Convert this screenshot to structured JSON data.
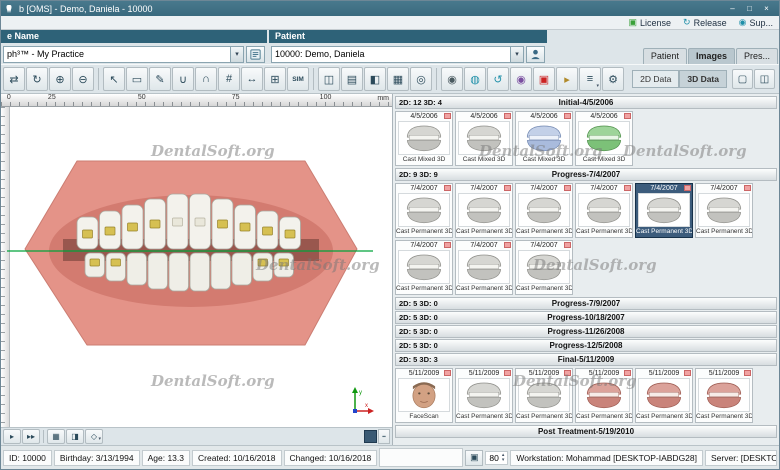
{
  "window": {
    "title": "b [OMS] - Demo, Daniela - 10000"
  },
  "titlebar_controls": [
    {
      "name": "minimize-button",
      "glyph": "–"
    },
    {
      "name": "maximize-button",
      "glyph": "□"
    },
    {
      "name": "close-button",
      "glyph": "×"
    }
  ],
  "top_status": [
    {
      "name": "license",
      "label": "License",
      "glyph": "▣",
      "color": "#3aa13a"
    },
    {
      "name": "release",
      "label": "Release",
      "glyph": "↻",
      "color": "#1e8fa8"
    },
    {
      "name": "support",
      "label": "Sup...",
      "glyph": "◉",
      "color": "#1e8fa8"
    }
  ],
  "practice": {
    "header": "e Name",
    "value": "ph³™ - My Practice"
  },
  "patient": {
    "header": "Patient",
    "value": "10000: Demo, Daniela"
  },
  "main_tabs": [
    {
      "label": "Patient",
      "active": false
    },
    {
      "label": "Images",
      "active": true
    },
    {
      "label": "Pres...",
      "active": false
    }
  ],
  "data_tabs": [
    {
      "label": "2D Data",
      "active": false
    },
    {
      "label": "3D Data",
      "active": true
    }
  ],
  "view_toggles": [
    {
      "name": "single-view-toggle",
      "glyph": "▢"
    },
    {
      "name": "split-view-toggle",
      "glyph": "◫"
    }
  ],
  "toolbar": [
    {
      "name": "pan-tool-icon",
      "glyph": "⇄"
    },
    {
      "name": "rotate-tool-icon",
      "glyph": "↻"
    },
    {
      "name": "zoom-in-tool-icon",
      "glyph": "⊕"
    },
    {
      "name": "zoom-out-tool-icon",
      "glyph": "⊖"
    },
    {
      "sep": true
    },
    {
      "name": "select-tool-icon",
      "glyph": "↖"
    },
    {
      "name": "rectangle-select-icon",
      "glyph": "▭"
    },
    {
      "name": "draw-tool-icon",
      "glyph": "✎"
    },
    {
      "name": "lower-arch-icon",
      "glyph": "∪"
    },
    {
      "name": "upper-arch-icon",
      "glyph": "∩"
    },
    {
      "name": "bracket-tool-icon",
      "glyph": "#"
    },
    {
      "name": "measure-tool-icon",
      "glyph": "↔"
    },
    {
      "name": "grid-tool-icon",
      "glyph": "⊞"
    },
    {
      "name": "sim-button",
      "glyph": "SIM",
      "text": true
    },
    {
      "sep": true
    },
    {
      "name": "mirror-tool-icon",
      "glyph": "◫"
    },
    {
      "name": "layers-icon",
      "glyph": "▤"
    },
    {
      "name": "clip-plane-icon",
      "glyph": "◧"
    },
    {
      "name": "mesh-icon",
      "glyph": "▦"
    },
    {
      "name": "camera-icon",
      "glyph": "◎"
    },
    {
      "sep": true
    },
    {
      "name": "eye-icon",
      "glyph": "◉",
      "color": "#4a5a60"
    },
    {
      "name": "web-icon",
      "glyph": "◍",
      "color": "#1e8fa8"
    },
    {
      "name": "sync-icon",
      "glyph": "↺",
      "color": "#1e8fa8"
    },
    {
      "name": "record-icon",
      "glyph": "◉",
      "color": "#7a4fa0"
    },
    {
      "name": "alert-icon",
      "glyph": "▣",
      "color": "#cc2222"
    },
    {
      "name": "folder-icon",
      "glyph": "▸",
      "color": "#b08a2a"
    },
    {
      "name": "print-icon",
      "glyph": "≡",
      "arrow": true
    },
    {
      "name": "settings-gear-icon",
      "glyph": "⚙"
    }
  ],
  "viewport": {
    "ruler": {
      "unit": "mm",
      "labels": [
        {
          "text": "0",
          "pos": 2
        },
        {
          "text": "25",
          "pos": 13
        },
        {
          "text": "50",
          "pos": 36
        },
        {
          "text": "75",
          "pos": 60
        },
        {
          "text": "100",
          "pos": 83
        }
      ]
    },
    "axes": {
      "x_label": "x",
      "y_label": "y",
      "x_color": "#cc2222",
      "y_color": "#119911",
      "z_color": "#2244cc"
    }
  },
  "vp_toolbar": [
    {
      "name": "play-button",
      "glyph": "▸"
    },
    {
      "name": "fast-forward-button",
      "glyph": "▸▸"
    },
    {
      "sep": true
    },
    {
      "name": "grid-view-button",
      "glyph": "▦"
    },
    {
      "name": "object-list-button",
      "glyph": "◨"
    },
    {
      "name": "3d-options-button",
      "glyph": "◇",
      "arrow": true
    }
  ],
  "vp_toolbar_right": [
    {
      "name": "background-color-button",
      "color": "#3a5a74"
    },
    {
      "name": "more-options-button",
      "glyph": "▪▪"
    }
  ],
  "watermark": {
    "text": "DentalSoft.org"
  },
  "gallery": {
    "sections": [
      {
        "counts": "2D: 12 3D: 4",
        "title": "Initial-4/5/2006",
        "thumbs": [
          {
            "date": "4/5/2006",
            "label": "Cast Mixed 3D",
            "tint": "gray"
          },
          {
            "date": "4/5/2006",
            "label": "Cast Mixed 3D",
            "tint": "gray"
          },
          {
            "date": "4/5/2006",
            "label": "Cast Mixed 3D",
            "tint": "blue"
          },
          {
            "date": "4/5/2006",
            "label": "Cast Mixed 3D",
            "tint": "green"
          }
        ]
      },
      {
        "counts": "2D: 9 3D: 9",
        "title": "Progress-7/4/2007",
        "thumbs": [
          {
            "date": "7/4/2007",
            "label": "Cast Permanent 3D",
            "tint": "gray"
          },
          {
            "date": "7/4/2007",
            "label": "Cast Permanent 3D",
            "tint": "gray"
          },
          {
            "date": "7/4/2007",
            "label": "Cast Permanent 3D",
            "tint": "gray"
          },
          {
            "date": "7/4/2007",
            "label": "Cast Permanent 3D",
            "tint": "gray"
          },
          {
            "date": "7/4/2007",
            "label": "Cast Permanent 3D",
            "tint": "gray",
            "selected": true
          },
          {
            "date": "7/4/2007",
            "label": "Cast Permanent 3D",
            "tint": "gray"
          },
          {
            "date": "7/4/2007",
            "label": "Cast Permanent 3D",
            "tint": "gray"
          },
          {
            "date": "7/4/2007",
            "label": "Cast Permanent 3D",
            "tint": "gray"
          },
          {
            "date": "7/4/2007",
            "label": "Cast Permanent 3D",
            "tint": "gray"
          }
        ]
      },
      {
        "counts": "2D: 5 3D: 0",
        "title": "Progress-7/9/2007",
        "thumbs": []
      },
      {
        "counts": "2D: 5 3D: 0",
        "title": "Progress-10/18/2007",
        "thumbs": []
      },
      {
        "counts": "2D: 5 3D: 0",
        "title": "Progress-11/26/2008",
        "thumbs": []
      },
      {
        "counts": "2D: 5 3D: 0",
        "title": "Progress-12/5/2008",
        "thumbs": []
      },
      {
        "counts": "2D: 5 3D: 3",
        "title": "Final-5/11/2009",
        "thumbs": [
          {
            "date": "5/11/2009",
            "label": "FaceScan",
            "tint": "face"
          },
          {
            "date": "5/11/2009",
            "label": "Cast Permanent 3D",
            "tint": "gray"
          },
          {
            "date": "5/11/2009",
            "label": "Cast Permanent 3D",
            "tint": "gray"
          },
          {
            "date": "5/11/2009",
            "label": "Cast Permanent 3D",
            "tint": "red"
          },
          {
            "date": "5/11/2009",
            "label": "Cast Permanent 3D",
            "tint": "red"
          },
          {
            "date": "5/11/2009",
            "label": "Cast Permanent 3D",
            "tint": "red"
          }
        ]
      },
      {
        "counts": "",
        "title": "Post Treatment-5/19/2010",
        "thumbs": []
      }
    ]
  },
  "tints": {
    "gray": {
      "top": "#d6d6d2",
      "bottom": "#c2c2be",
      "stroke": "#8f8f8a",
      "teeth": "#f4f4f0"
    },
    "blue": {
      "top": "#c3d0e8",
      "bottom": "#a9bbdd",
      "stroke": "#7187b0",
      "teeth": "#eef2fa"
    },
    "green": {
      "top": "#9ed49a",
      "bottom": "#7cc178",
      "stroke": "#4e8f4a",
      "teeth": "#e8f6e6"
    },
    "red": {
      "top": "#dba29a",
      "bottom": "#c9837a",
      "stroke": "#9c5a50",
      "teeth": "#f6ece8"
    },
    "face": {
      "skin": "#d2a183",
      "hair": "#8a6a52",
      "stroke": "#a87b5e"
    }
  },
  "colors": {
    "header_teal": "#2e6278",
    "selection_blue": "#3c5c7c",
    "marker_pink": "#f0a2a2",
    "occlusal_green": "#00a33a",
    "model_pink": "#e49388"
  },
  "status_bar": {
    "items": [
      "ID: 10000",
      "Birthday: 3/13/1994",
      "Age: 13.3",
      "Created: 10/16/2018",
      "Changed: 10/16/2018"
    ],
    "icon_button": {
      "name": "patient-photo-button",
      "glyph": "▣"
    },
    "zoom_value": "80",
    "workstation": "Workstation: Mohammad [DESKTOP-IABDG28]",
    "server": "Server: [DESKTOP-IA"
  },
  "ui": {
    "dropdown_glyph": "▾",
    "spin_up": "▴",
    "spin_down": "▾"
  }
}
